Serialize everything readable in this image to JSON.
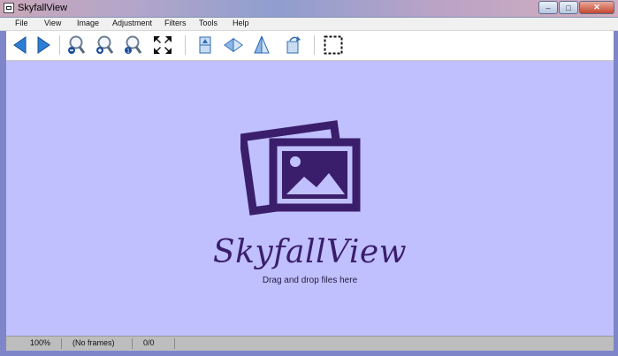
{
  "window": {
    "title": "SkyfallView"
  },
  "menu": [
    "File",
    "View",
    "Image",
    "Adjustment",
    "Filters",
    "Tools",
    "Help"
  ],
  "toolbar": {
    "buttons": [
      {
        "name": "back-arrow-icon"
      },
      {
        "name": "forward-arrow-icon"
      },
      {
        "name": "zoom-out-icon"
      },
      {
        "name": "zoom-in-icon"
      },
      {
        "name": "zoom-original-icon"
      },
      {
        "name": "fit-screen-icon"
      },
      {
        "name": "flip-vertical-icon"
      },
      {
        "name": "flip-horizontal-icon"
      },
      {
        "name": "mirror-icon"
      },
      {
        "name": "rotate-icon"
      },
      {
        "name": "select-region-icon"
      }
    ]
  },
  "canvas": {
    "brand": "SkyfallView",
    "hint": "Drag and drop files here"
  },
  "status": {
    "zoom": "100%",
    "frames": "(No frames)",
    "position": "0/0"
  },
  "colors": {
    "canvas_bg": "#c0c0fe",
    "logo": "#3a1e6c"
  }
}
